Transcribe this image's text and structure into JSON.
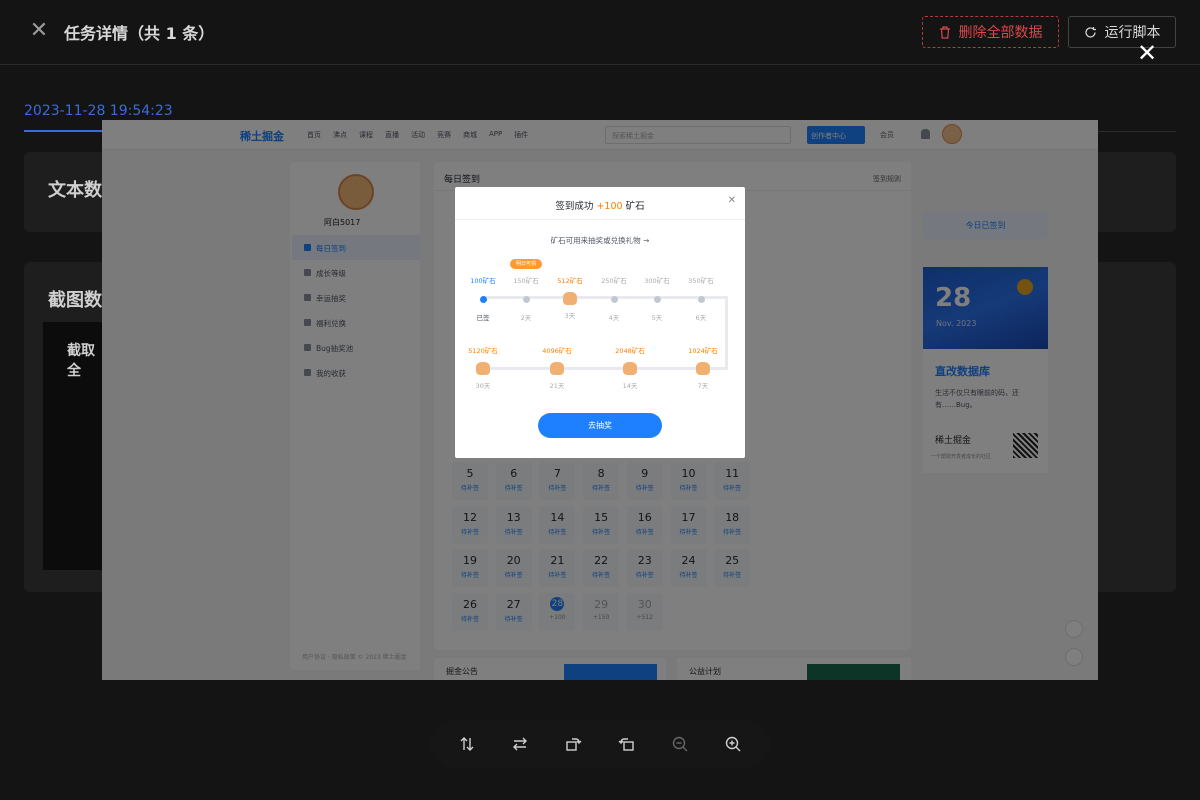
{
  "header": {
    "title": "任务详情（共 1 条）",
    "delete_all_label": "删除全部数据",
    "run_script_label": "运行脚本"
  },
  "record": {
    "timestamp_tab": "2023-11-28 19:54:23",
    "text_section_title": "文本数",
    "screenshot_section_title": "截图数",
    "screenshot_subtab": "截取全"
  },
  "screenshot": {
    "site": {
      "logo_text": "稀土掘金",
      "nav": [
        "首页",
        "沸点",
        "课程",
        "直播",
        "活动",
        "竞赛",
        "商城",
        "APP",
        "插件"
      ],
      "search_placeholder": "探索稀土掘金",
      "create_label": "创作者中心",
      "vip_label": "会员"
    },
    "sidebar": {
      "username": "阿白5017",
      "items": [
        "每日签到",
        "成长等级",
        "幸运抽奖",
        "福利兑换",
        "Bug抽奖池",
        "我的收获"
      ],
      "footer": "用户协议 · 隐私政策 © 2023 稀土掘金"
    },
    "main": {
      "title": "每日签到",
      "rules_link": "签到规则",
      "calendar": [
        {
          "day": "5",
          "status": "待补签"
        },
        {
          "day": "6",
          "status": "待补签"
        },
        {
          "day": "7",
          "status": "待补签"
        },
        {
          "day": "8",
          "status": "待补签"
        },
        {
          "day": "9",
          "status": "待补签"
        },
        {
          "day": "10",
          "status": "待补签"
        },
        {
          "day": "11",
          "status": "待补签"
        },
        {
          "day": "12",
          "status": "待补签"
        },
        {
          "day": "13",
          "status": "待补签"
        },
        {
          "day": "14",
          "status": "待补签"
        },
        {
          "day": "15",
          "status": "待补签"
        },
        {
          "day": "16",
          "status": "待补签"
        },
        {
          "day": "17",
          "status": "待补签"
        },
        {
          "day": "18",
          "status": "待补签"
        },
        {
          "day": "19",
          "status": "待补签"
        },
        {
          "day": "20",
          "status": "待补签"
        },
        {
          "day": "21",
          "status": "待补签"
        },
        {
          "day": "22",
          "status": "待补签"
        },
        {
          "day": "23",
          "status": "待补签"
        },
        {
          "day": "24",
          "status": "待补签"
        },
        {
          "day": "25",
          "status": "待补签"
        },
        {
          "day": "26",
          "status": "待补签"
        },
        {
          "day": "27",
          "status": "待补签"
        },
        {
          "day": "28",
          "status": "+100"
        },
        {
          "day": "29",
          "status": "+150"
        },
        {
          "day": "30",
          "status": "+512"
        }
      ]
    },
    "right": {
      "signed_label": "今日已签到",
      "poster_day": "28",
      "poster_month": "Nov. 2023",
      "poster_title": "直改数据库",
      "poster_desc": "生活不仅只有眼前的码，还有……Bug。",
      "poster_brand": "稀土掘金",
      "poster_sub": "一个帮助开发者成长的社区"
    },
    "bottom": {
      "left_title": "掘金公告",
      "right_title": "公益计划"
    },
    "modal": {
      "title_prefix": "签到成功",
      "title_highlight": "+100",
      "title_suffix": "矿石",
      "hint": "矿石可用来抽奖或兑换礼物 →",
      "badge": "明日可领",
      "row1": [
        {
          "amount": "100矿石",
          "label": "已签"
        },
        {
          "amount": "150矿石",
          "label": "2天"
        },
        {
          "amount": "512矿石",
          "label": "3天"
        },
        {
          "amount": "250矿石",
          "label": "4天"
        },
        {
          "amount": "300矿石",
          "label": "5天"
        },
        {
          "amount": "350矿石",
          "label": "6天"
        }
      ],
      "row2": [
        {
          "amount": "5120矿石",
          "label": "30天"
        },
        {
          "amount": "4096矿石",
          "label": "21天"
        },
        {
          "amount": "2048矿石",
          "label": "14天"
        },
        {
          "amount": "1024矿石",
          "label": "7天"
        }
      ],
      "button": "去抽奖"
    }
  },
  "colors": {
    "accent": "#1e80ff",
    "danger": "#d54a4a",
    "ore": "#ff7d00"
  }
}
